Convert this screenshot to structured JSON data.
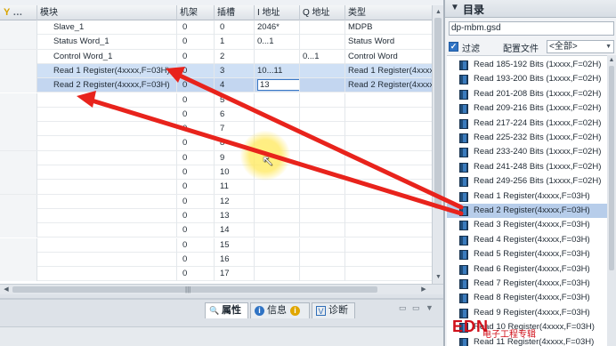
{
  "table": {
    "headers": {
      "module": "模块",
      "rack": "机架",
      "slot": "插槽",
      "iaddr": "I 地址",
      "qaddr": "Q 地址",
      "type": "类型"
    },
    "rows": [
      {
        "module": "Slave_1",
        "rack": "0",
        "slot": "0",
        "iaddr": "2046*",
        "qaddr": "",
        "type": "MDPB"
      },
      {
        "module": "Status Word_1",
        "rack": "0",
        "slot": "1",
        "iaddr": "0...1",
        "qaddr": "",
        "type": "Status Word"
      },
      {
        "module": "Control Word_1",
        "rack": "0",
        "slot": "2",
        "iaddr": "",
        "qaddr": "0...1",
        "type": "Control Word"
      },
      {
        "module": "Read 1 Register(4xxxx,F=03H)",
        "rack": "0",
        "slot": "3",
        "iaddr": "10...11",
        "qaddr": "",
        "type": "Read 1 Register(4xxxx,F=03H)"
      },
      {
        "module": "Read 2 Register(4xxxx,F=03H)",
        "rack": "0",
        "slot": "4",
        "iaddr": "13",
        "qaddr": "",
        "type": "Read 2 Register(4xxxx,F=03H)"
      },
      {
        "module": "",
        "rack": "0",
        "slot": "5",
        "iaddr": "",
        "qaddr": "",
        "type": ""
      },
      {
        "module": "",
        "rack": "0",
        "slot": "6",
        "iaddr": "",
        "qaddr": "",
        "type": ""
      },
      {
        "module": "",
        "rack": "0",
        "slot": "7",
        "iaddr": "",
        "qaddr": "",
        "type": ""
      },
      {
        "module": "",
        "rack": "0",
        "slot": "8",
        "iaddr": "",
        "qaddr": "",
        "type": ""
      },
      {
        "module": "",
        "rack": "0",
        "slot": "9",
        "iaddr": "",
        "qaddr": "",
        "type": ""
      },
      {
        "module": "",
        "rack": "0",
        "slot": "10",
        "iaddr": "",
        "qaddr": "",
        "type": ""
      },
      {
        "module": "",
        "rack": "0",
        "slot": "11",
        "iaddr": "",
        "qaddr": "",
        "type": ""
      },
      {
        "module": "",
        "rack": "0",
        "slot": "12",
        "iaddr": "",
        "qaddr": "",
        "type": ""
      },
      {
        "module": "",
        "rack": "0",
        "slot": "13",
        "iaddr": "",
        "qaddr": "",
        "type": ""
      },
      {
        "module": "",
        "rack": "0",
        "slot": "14",
        "iaddr": "",
        "qaddr": "",
        "type": ""
      },
      {
        "module": "",
        "rack": "0",
        "slot": "15",
        "iaddr": "",
        "qaddr": "",
        "type": ""
      },
      {
        "module": "",
        "rack": "0",
        "slot": "16",
        "iaddr": "",
        "qaddr": "",
        "type": ""
      },
      {
        "module": "",
        "rack": "0",
        "slot": "17",
        "iaddr": "",
        "qaddr": "",
        "type": ""
      }
    ]
  },
  "properties_tabs": [
    {
      "label": "属性",
      "icon": "properties-icon"
    },
    {
      "label": "信息",
      "icon": "info-icon"
    },
    {
      "label": "诊断",
      "icon": "diagnostics-icon"
    }
  ],
  "catalog": {
    "title": "目录",
    "search_value": "dp-mbm.gsd",
    "filter_label": "过滤",
    "profile_label": "配置文件",
    "profile_value": "<全部>",
    "items": [
      "Read 185-192 Bits (1xxxx,F=02H)",
      "Read 193-200 Bits (1xxxx,F=02H)",
      "Read 201-208 Bits (1xxxx,F=02H)",
      "Read 209-216 Bits (1xxxx,F=02H)",
      "Read 217-224 Bits (1xxxx,F=02H)",
      "Read 225-232 Bits (1xxxx,F=02H)",
      "Read 233-240 Bits (1xxxx,F=02H)",
      "Read 241-248 Bits (1xxxx,F=02H)",
      "Read 249-256 Bits (1xxxx,F=02H)",
      "Read 1 Register(4xxxx,F=03H)",
      "Read 2 Register(4xxxx,F=03H)",
      "Read 3 Register(4xxxx,F=03H)",
      "Read 4 Register(4xxxx,F=03H)",
      "Read 5 Register(4xxxx,F=03H)",
      "Read 6 Register(4xxxx,F=03H)",
      "Read 7 Register(4xxxx,F=03H)",
      "Read 8 Register(4xxxx,F=03H)",
      "Read 9 Register(4xxxx,F=03H)",
      "Read 10 Register(4xxxx,F=03H)",
      "Read 11 Register(4xxxx,F=03H)"
    ],
    "highlighted_index": 10
  },
  "watermark": {
    "logo": "EDN",
    "site": "电子工程专辑"
  },
  "colors": {
    "selection": "#cfe0f5",
    "arrow": "#e8231c",
    "highlight": "#b7cdea"
  }
}
